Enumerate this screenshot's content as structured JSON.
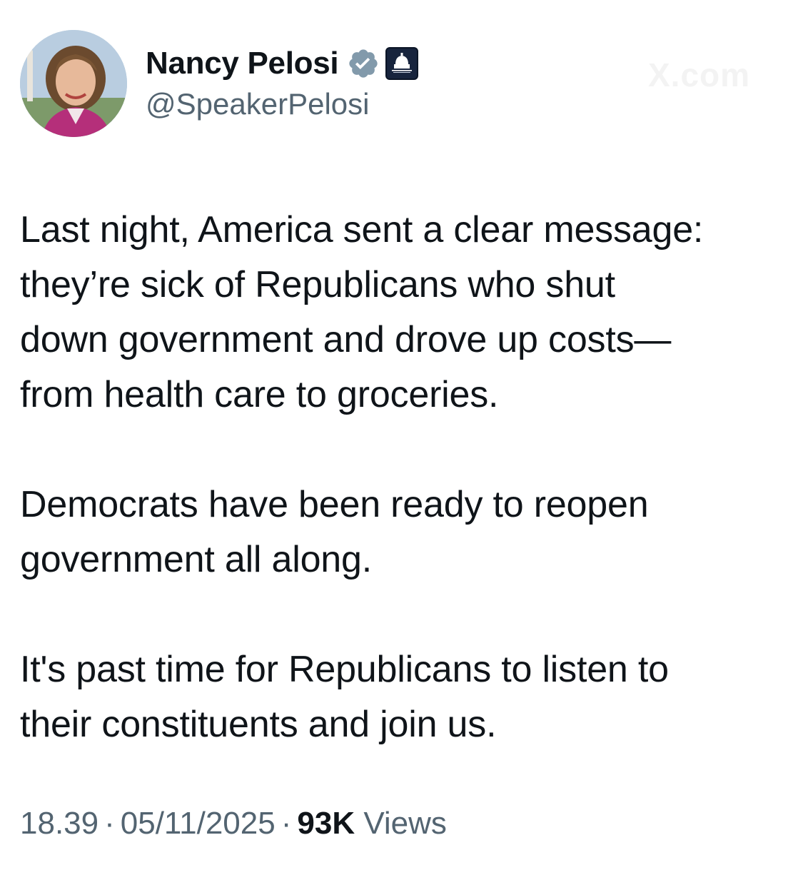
{
  "author": {
    "display_name": "Nancy Pelosi",
    "handle": "@SpeakerPelosi",
    "verified": true,
    "verified_color": "#829aab",
    "affiliate_badge": "capitol-dome-icon"
  },
  "tweet": {
    "paragraphs": [
      "Last night, America sent a clear message:\nthey’re sick of Republicans who shut\ndown government and drove up costs—\nfrom health care to groceries.",
      "Democrats have been ready to reopen\ngovernment all along.",
      "It's past time for Republicans to listen to\ntheir constituents and join us."
    ]
  },
  "meta": {
    "time": "18.39",
    "date": "05/11/2025",
    "separator": "·",
    "views_count": "93K",
    "views_label": "Views"
  }
}
